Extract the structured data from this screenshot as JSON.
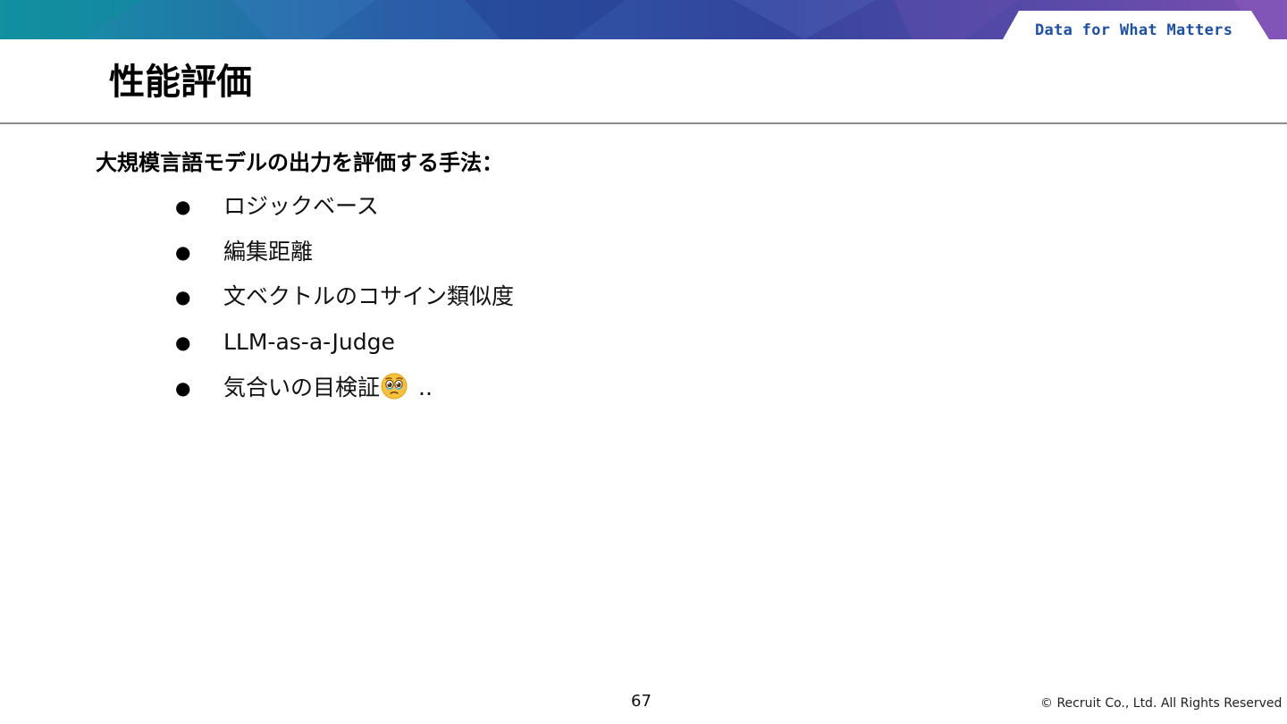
{
  "header": {
    "tagline": "Data for What Matters",
    "brand_colors": {
      "teal": "#1a9aa8",
      "blue": "#2c4aa0",
      "purple": "#7a4fb0",
      "tagline": "#1f4f9f"
    }
  },
  "slide": {
    "title": "性能評価",
    "lead": "大規模言語モデルの出力を評価する手法：",
    "items": [
      {
        "text": "ロジックベース"
      },
      {
        "text": "編集距離"
      },
      {
        "text": "文ベクトルのコサイン類似度"
      },
      {
        "text": "LLM-as-a-Judge"
      },
      {
        "text": "気合いの目検証",
        "emoji": "face-holding-back-tears-icon",
        "suffix": ".."
      }
    ],
    "bullet_glyph": "●"
  },
  "footer": {
    "page_number": "67",
    "copyright": "© Recruit Co., Ltd. All Rights Reserved"
  }
}
